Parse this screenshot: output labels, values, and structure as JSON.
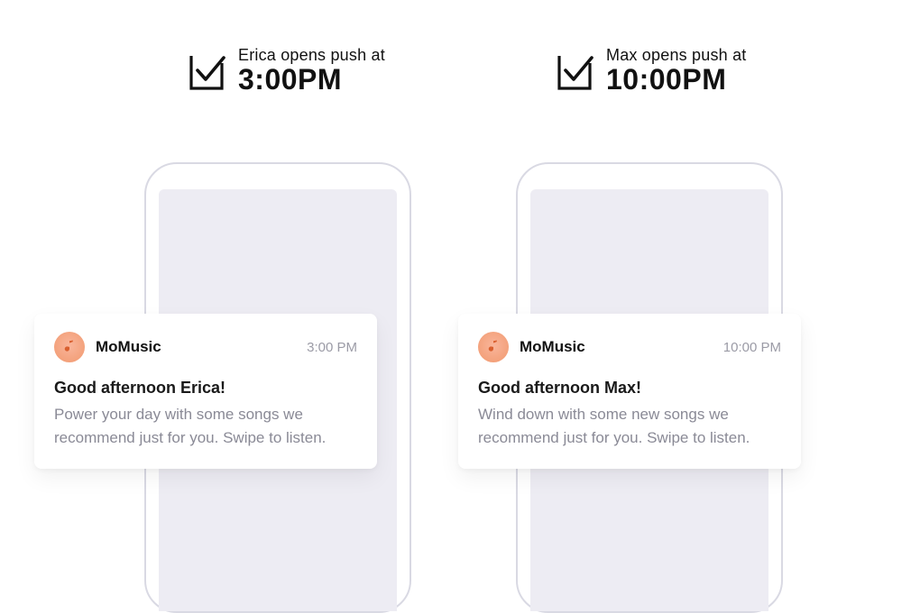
{
  "headers": [
    {
      "label": "Erica opens push at",
      "time": "3:00PM"
    },
    {
      "label": "Max opens push at",
      "time": "10:00PM"
    }
  ],
  "notifications": [
    {
      "app_name": "MoMusic",
      "time": "3:00 PM",
      "title": "Good afternoon Erica!",
      "body": "Power your day with some songs we recommend just for you. Swipe to listen."
    },
    {
      "app_name": "MoMusic",
      "time": "10:00 PM",
      "title": "Good afternoon Max!",
      "body": "Wind down with some new songs we recommend just for you. Swipe to listen."
    }
  ],
  "colors": {
    "icon_bg": "#f39e78",
    "phone_border": "#d9d9e3",
    "screen_bg": "#edecf3",
    "muted_text": "#8a8a96"
  }
}
